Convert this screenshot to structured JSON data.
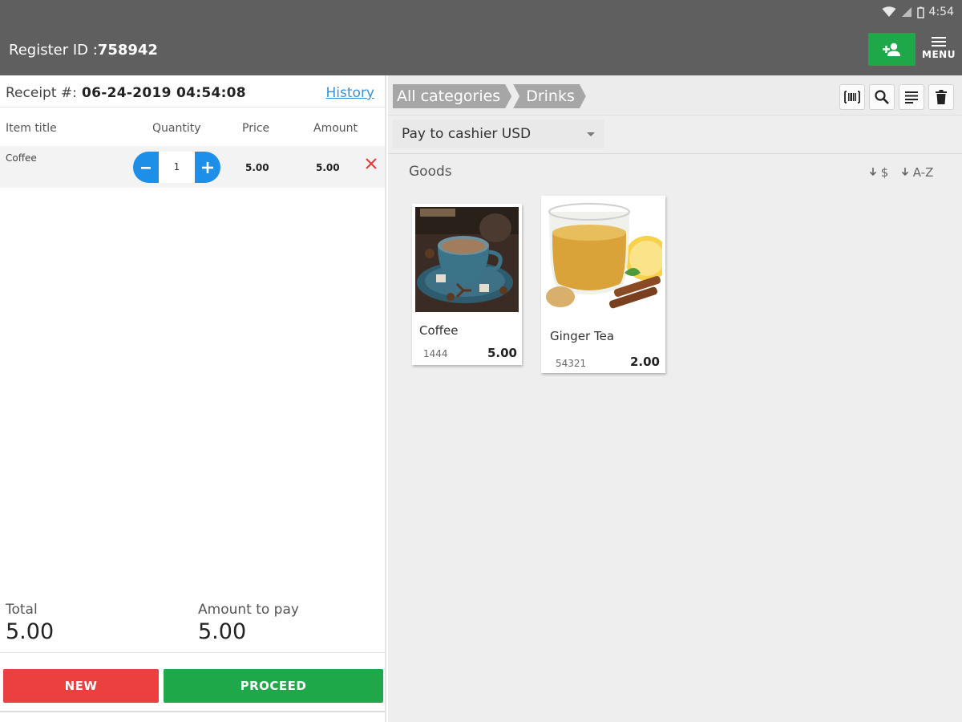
{
  "status_bar": {
    "time": "4:54"
  },
  "header": {
    "register_label": "Register ID :",
    "register_id": "758942",
    "menu_label": "MENU"
  },
  "receipt": {
    "label": "Receipt #:",
    "number": "06-24-2019 04:54:08",
    "history_label": "History"
  },
  "table": {
    "columns": [
      "Item title",
      "Quantity",
      "Price",
      "Amount"
    ],
    "rows": [
      {
        "title": "Coffee",
        "quantity": "1",
        "price": "5.00",
        "amount": "5.00"
      }
    ]
  },
  "totals": {
    "total_label": "Total",
    "total_value": "5.00",
    "pay_label": "Amount to pay",
    "pay_value": "5.00"
  },
  "actions": {
    "new_label": "NEW",
    "proceed_label": "PROCEED"
  },
  "breadcrumb": [
    "All categories",
    "Drinks"
  ],
  "payment_method": "Pay to cashier USD",
  "goods": {
    "label": "Goods",
    "sort_price": "$",
    "sort_name": "A-Z",
    "products": [
      {
        "name": "Coffee",
        "code": "1444",
        "price": "5.00"
      },
      {
        "name": "Ginger Tea",
        "code": "54321",
        "price": "2.00"
      }
    ]
  },
  "colors": {
    "app_bar": "#5f5f5f",
    "green": "#1fa84a",
    "red": "#ea4040",
    "blue": "#1e8fe8",
    "link": "#3a90d8"
  }
}
